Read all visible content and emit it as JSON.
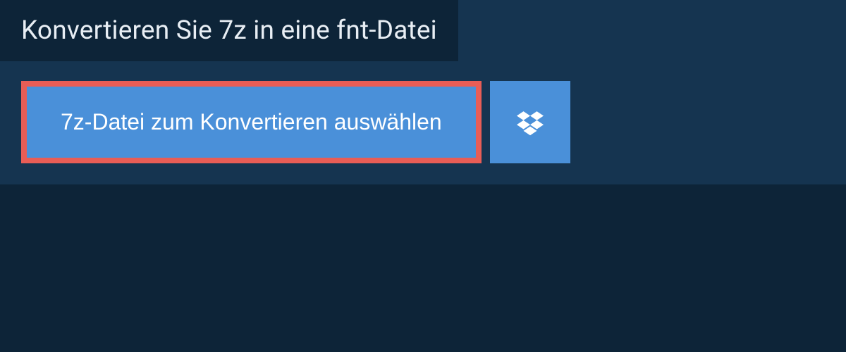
{
  "header": {
    "title": "Konvertieren Sie 7z in eine fnt-Datei"
  },
  "actions": {
    "select_file_label": "7z-Datei zum Konvertieren auswählen",
    "dropbox_icon_name": "dropbox-icon"
  },
  "colors": {
    "background_dark": "#0d2438",
    "background_panel": "#153450",
    "button_primary": "#4a90d9",
    "highlight_border": "#e85d56"
  }
}
